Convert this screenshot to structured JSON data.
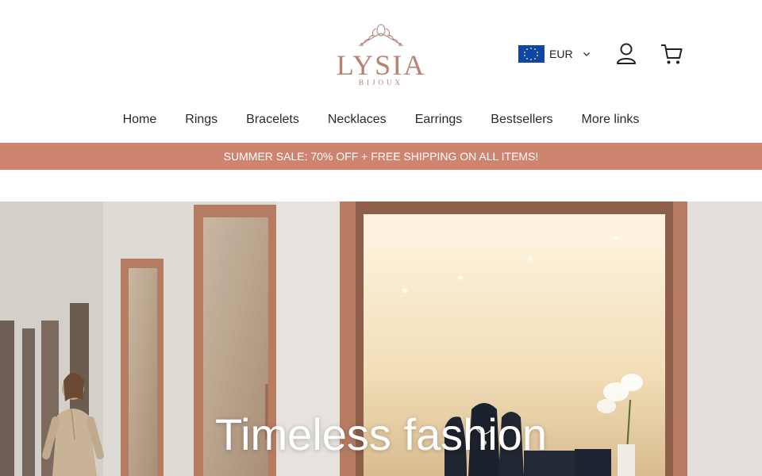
{
  "header": {
    "logo": {
      "wordmark": "LYSIA",
      "subtitle": "BIJOUX",
      "mark_icon": "floral-wreath-icon"
    },
    "currency": {
      "code": "EUR",
      "flag_icon": "eu-flag-icon",
      "dropdown_icon": "chevron-down-icon"
    },
    "account_icon": "user-icon",
    "cart_icon": "cart-icon"
  },
  "nav": {
    "items": [
      {
        "label": "Home"
      },
      {
        "label": "Rings"
      },
      {
        "label": "Bracelets"
      },
      {
        "label": "Necklaces"
      },
      {
        "label": "Earrings"
      },
      {
        "label": "Bestsellers"
      },
      {
        "label": "More links"
      }
    ]
  },
  "announcement": {
    "text": "SUMMER SALE: 70% OFF + FREE SHIPPING ON ALL ITEMS!"
  },
  "hero": {
    "title": "Timeless fashion",
    "image_icon": "jewelry-storefront-photo",
    "colors": {
      "frame": "#b57c62",
      "wall": "#dcd8d2",
      "banner": "#cf8470"
    }
  }
}
